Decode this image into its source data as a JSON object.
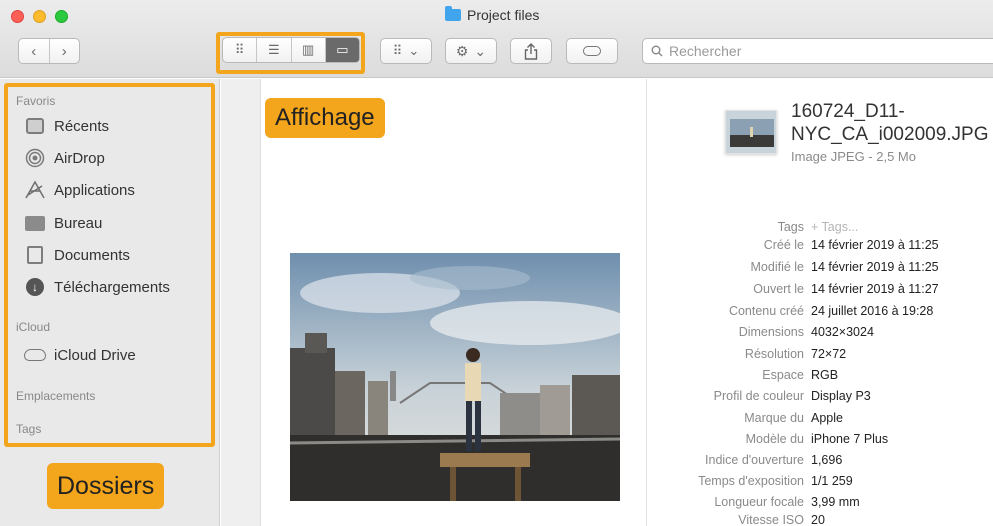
{
  "window": {
    "title": "Project files"
  },
  "toolbar": {
    "back_icon": "chevron-left-icon",
    "forward_icon": "chevron-right-icon",
    "view_modes": [
      {
        "name": "icons",
        "glyph": "⋮⋮"
      },
      {
        "name": "list",
        "glyph": "☰"
      },
      {
        "name": "columns",
        "glyph": "▥"
      },
      {
        "name": "gallery",
        "glyph": "▬",
        "active": true
      }
    ],
    "search_placeholder": "Rechercher"
  },
  "annotations": {
    "view_label": "Affichage",
    "folders_label": "Dossiers",
    "accent_color": "#f3a51c"
  },
  "sidebar": {
    "favorites_heading": "Favoris",
    "favorites": [
      {
        "label": "Récents",
        "icon": "recents-icon"
      },
      {
        "label": "AirDrop",
        "icon": "airdrop-icon"
      },
      {
        "label": "Applications",
        "icon": "applications-icon"
      },
      {
        "label": "Bureau",
        "icon": "desktop-icon"
      },
      {
        "label": "Documents",
        "icon": "documents-icon"
      },
      {
        "label": "Téléchargements",
        "icon": "downloads-icon"
      }
    ],
    "icloud_heading": "iCloud",
    "icloud_items": [
      {
        "label": "iCloud Drive",
        "icon": "cloud-icon"
      }
    ],
    "locations_heading": "Emplacements",
    "tags_heading": "Tags"
  },
  "info": {
    "file_name": "160724_D11-NYC_CA_i002009.JPG",
    "file_type": "Image JPEG - 2,5 Mo",
    "metadata": [
      {
        "key": "Tags",
        "value": "+ Tags..."
      },
      {
        "key": "Créé le",
        "value": "14 février 2019 à 11:25"
      },
      {
        "key": "Modifié le",
        "value": "14 février 2019 à 11:25"
      },
      {
        "key": "Ouvert le",
        "value": "14 février 2019 à 11:27"
      },
      {
        "key": "Contenu créé",
        "value": "24 juillet 2016 à 19:28"
      },
      {
        "key": "Dimensions",
        "value": "4032×3024"
      },
      {
        "key": "Résolution",
        "value": "72×72"
      },
      {
        "key": "Espace",
        "value": "RGB"
      },
      {
        "key": "Profil de couleur",
        "value": "Display P3"
      },
      {
        "key": "Marque du",
        "value": "Apple"
      },
      {
        "key": "Modèle du",
        "value": "iPhone 7 Plus"
      },
      {
        "key": "Indice d'ouverture",
        "value": "1,696"
      },
      {
        "key": "Temps d'exposition",
        "value": "1/1 259"
      },
      {
        "key": "Longueur focale",
        "value": "3,99 mm"
      },
      {
        "key": "Vitesse ISO",
        "value": "20"
      }
    ]
  }
}
